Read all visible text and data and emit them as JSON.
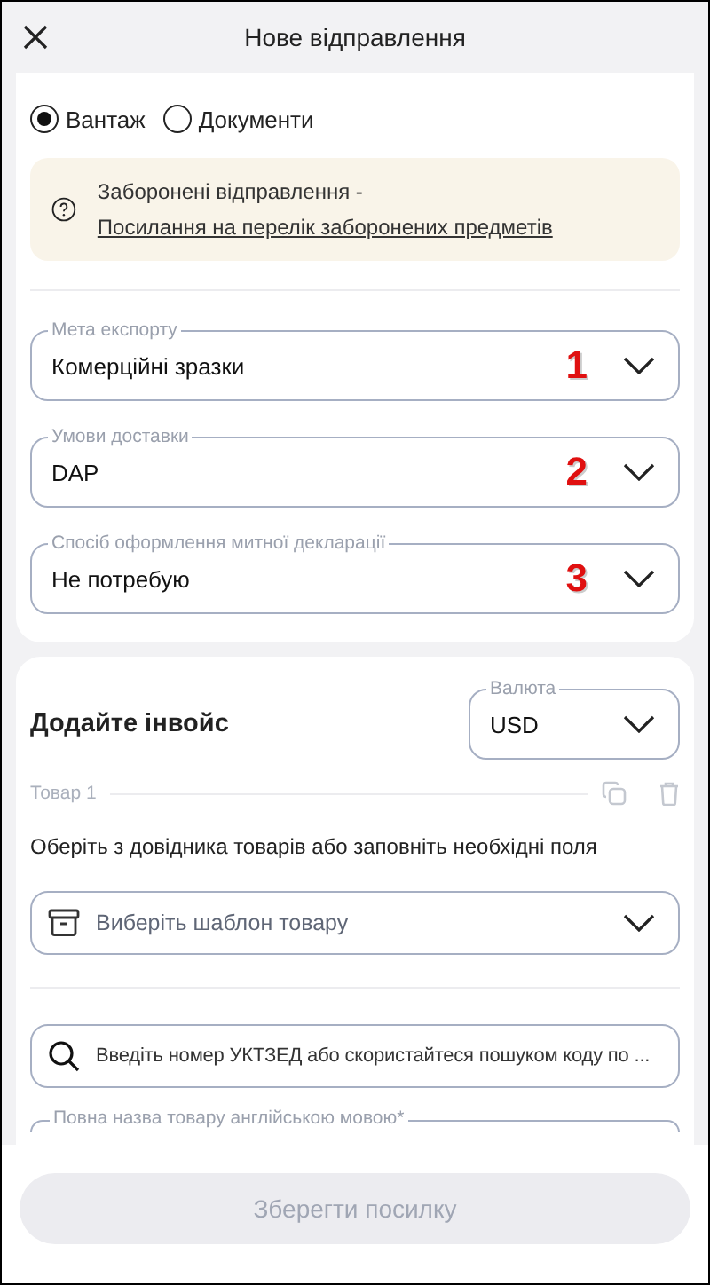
{
  "header": {
    "title": "Нове відправлення"
  },
  "shipment_type": [
    {
      "label": "Вантаж",
      "selected": true
    },
    {
      "label": "Документи",
      "selected": false
    }
  ],
  "notice": {
    "text": "Заборонені відправлення - ",
    "link": "Посилання на перелік заборонених предметів"
  },
  "export_fields": [
    {
      "label": "Мета експорту",
      "value": "Комерційні зразки",
      "annotation": "1"
    },
    {
      "label": "Умови доставки",
      "value": "DAP",
      "annotation": "2"
    },
    {
      "label": "Спосіб оформлення митної декларації",
      "value": "Не потребую",
      "annotation": "3"
    }
  ],
  "invoice": {
    "title": "Додайте інвойс",
    "currency": {
      "label": "Валюта",
      "value": "USD"
    },
    "item": {
      "label": "Товар 1",
      "hint": "Оберіть з довідника товарів або заповніть необхідні поля",
      "template": {
        "placeholder": "Виберіть шаблон товару"
      },
      "search": {
        "placeholder": "Введіть номер УКТЗЕД або скористайтеся пошуком коду по ..."
      },
      "name_field": {
        "label": "Повна назва товару англійською мовою*"
      }
    }
  },
  "footer": {
    "button": {
      "label": "Зберегти посилку",
      "disabled": true
    }
  }
}
